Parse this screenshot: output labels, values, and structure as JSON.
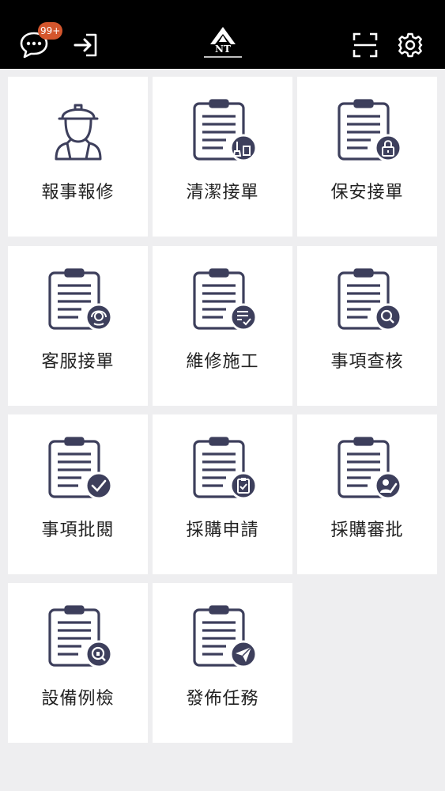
{
  "header": {
    "badge_count": "99+",
    "logo_text": "NT",
    "icons": [
      "chat-icon",
      "logout-icon",
      "scan-icon",
      "gear-icon"
    ]
  },
  "colors": {
    "icon": "#3d3f5c",
    "badge": "#d4562d",
    "bar": "#000000"
  },
  "tiles": [
    {
      "label": "報事報修",
      "icon": "worker-icon"
    },
    {
      "label": "清潔接單",
      "icon": "cleaning-icon"
    },
    {
      "label": "保安接單",
      "icon": "lock-icon"
    },
    {
      "label": "客服接單",
      "icon": "headset-icon"
    },
    {
      "label": "維修施工",
      "icon": "checklist-icon"
    },
    {
      "label": "事項查核",
      "icon": "search-icon"
    },
    {
      "label": "事項批閱",
      "icon": "check-icon"
    },
    {
      "label": "採購申請",
      "icon": "clipboard-icon"
    },
    {
      "label": "採購審批",
      "icon": "user-edit-icon"
    },
    {
      "label": "設備例檢",
      "icon": "inspect-icon"
    },
    {
      "label": "發佈任務",
      "icon": "send-icon"
    }
  ]
}
